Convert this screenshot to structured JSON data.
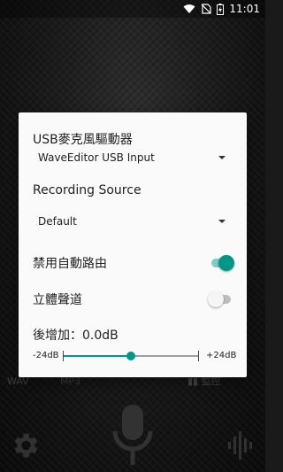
{
  "status_bar": {
    "time": "11:01",
    "icons": [
      "wifi-icon",
      "no-sim-icon",
      "battery-charging-icon"
    ]
  },
  "background_app": {
    "tabs": [
      "WAV",
      "MP3"
    ],
    "monitor_label": "監控",
    "icons": [
      "gear-icon",
      "microphone-icon",
      "waveform-icon"
    ]
  },
  "dialog": {
    "usb_driver": {
      "title": "USB麥克風驅動器",
      "selected": "WaveEditor USB Input"
    },
    "recording_source": {
      "title": "Recording Source",
      "selected": "Default"
    },
    "disable_auto_routing": {
      "label": "禁用自動路由",
      "checked": true
    },
    "stereo": {
      "label": "立體聲道",
      "checked": false
    },
    "gain": {
      "label": "後增加：0.0dB",
      "min_label": "-24dB",
      "max_label": "+24dB",
      "min": -24,
      "max": 24,
      "value": 0
    }
  },
  "colors": {
    "accent": "#009688",
    "accent_light": "#80cbc4",
    "dialog_bg": "#fafafa"
  }
}
